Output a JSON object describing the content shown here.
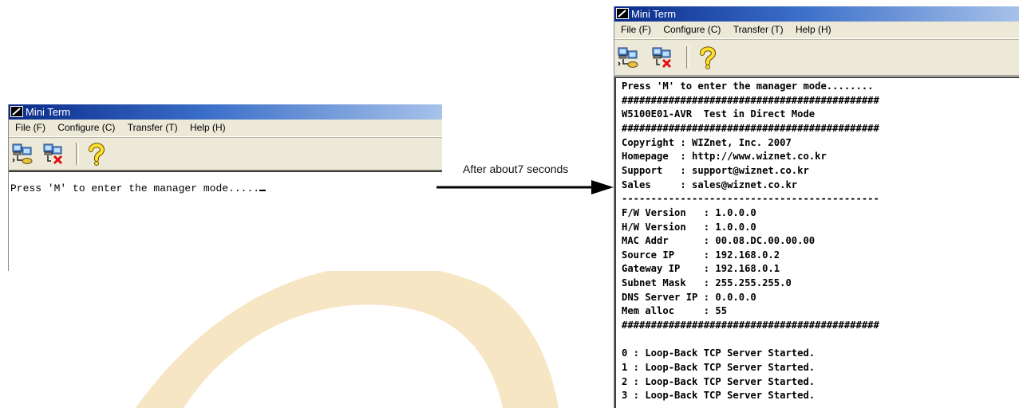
{
  "colors": {
    "watermark": "#f7e6c4",
    "titlebar_start": "#0a2a8a",
    "titlebar_end": "#a7c2ea",
    "chrome": "#ece9d8"
  },
  "before": {
    "window_title": "Mini Term",
    "menu": [
      "File (F)",
      "Configure (C)",
      "Transfer (T)",
      "Help (H)"
    ],
    "toolbar_icons": [
      "connect-icon",
      "disconnect-icon",
      "help-icon"
    ],
    "terminal_text": "Press 'M' to enter the manager mode....."
  },
  "arrow": {
    "label": "After about7 seconds"
  },
  "after": {
    "window_title": "Mini Term",
    "menu": [
      "File (F)",
      "Configure (C)",
      "Transfer (T)",
      "Help (H)"
    ],
    "toolbar_icons": [
      "connect-icon",
      "disconnect-icon",
      "help-icon"
    ],
    "terminal_lines": [
      "Press 'M' to enter the manager mode........",
      "############################################",
      "W5100E01-AVR  Test in Direct Mode",
      "############################################",
      "Copyright : WIZnet, Inc. 2007",
      "Homepage  : http://www.wiznet.co.kr",
      "Support   : support@wiznet.co.kr",
      "Sales     : sales@wiznet.co.kr",
      "--------------------------------------------",
      "F/W Version   : 1.0.0.0",
      "H/W Version   : 1.0.0.0",
      "MAC Addr      : 00.08.DC.00.00.00",
      "Source IP     : 192.168.0.2",
      "Gateway IP    : 192.168.0.1",
      "Subnet Mask   : 255.255.255.0",
      "DNS Server IP : 0.0.0.0",
      "Mem alloc     : 55",
      "############################################",
      "",
      "0 : Loop-Back TCP Server Started.",
      "1 : Loop-Back TCP Server Started.",
      "2 : Loop-Back TCP Server Started.",
      "3 : Loop-Back TCP Server Started."
    ]
  }
}
